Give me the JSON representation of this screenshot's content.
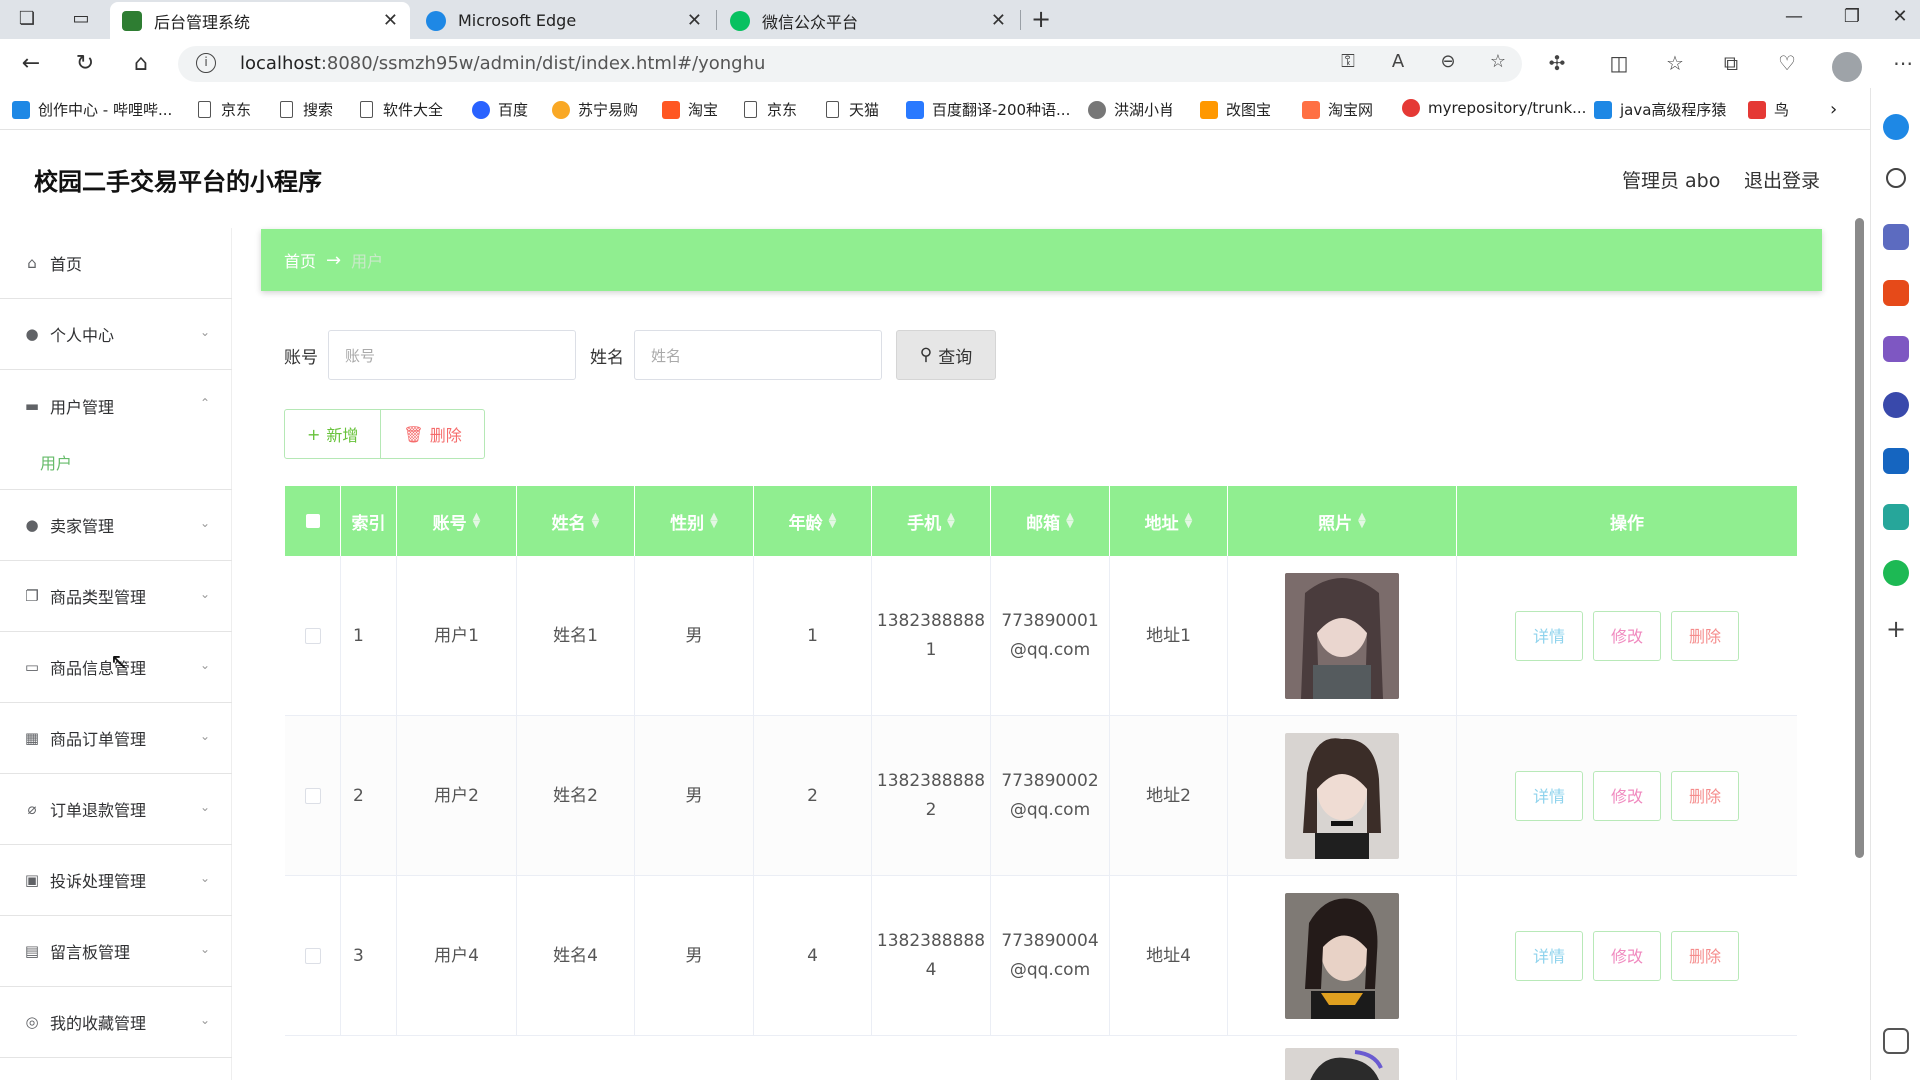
{
  "browser": {
    "tabs": [
      {
        "title": "后台管理系统",
        "color": "#2e7d32"
      },
      {
        "title": "Microsoft Edge",
        "color": "#1e88e5"
      },
      {
        "title": "微信公众平台",
        "color": "#07c160"
      }
    ],
    "url_host": "localhost",
    "url_rest": ":8080/ssmzh95w/admin/dist/index.html#/yonghu",
    "bookmarks": [
      {
        "label": "创作中心 - 哔哩哔...",
        "icon": "bilibili-icon",
        "color": "#1e88e5"
      },
      {
        "label": "京东",
        "icon": "page-icon"
      },
      {
        "label": "搜索",
        "icon": "page-icon"
      },
      {
        "label": "软件大全",
        "icon": "page-icon"
      },
      {
        "label": "百度",
        "icon": "baidu-icon",
        "color": "#2962ff"
      },
      {
        "label": "苏宁易购",
        "icon": "suning-icon",
        "color": "#f9a825"
      },
      {
        "label": "淘宝",
        "icon": "taobao-icon",
        "color": "#ff5722"
      },
      {
        "label": "京东",
        "icon": "page-icon"
      },
      {
        "label": "天猫",
        "icon": "page-icon"
      },
      {
        "label": "百度翻译-200种语...",
        "icon": "baidu-translate-icon",
        "color": "#2979ff"
      },
      {
        "label": "洪湖小肖",
        "icon": "hunter-icon",
        "color": "#777777"
      },
      {
        "label": "改图宝",
        "icon": "gaitubao-icon",
        "color": "#ff9800"
      },
      {
        "label": "淘宝网",
        "icon": "taobao-icon",
        "color": "#ff7043"
      },
      {
        "label": "myrepository/trunk...",
        "icon": "chrome-icon",
        "color": "#e53935"
      },
      {
        "label": "java高级程序猿",
        "icon": "bilibili-icon",
        "color": "#1e88e5"
      },
      {
        "label": "鸟",
        "icon": "bird-icon",
        "color": "#e53935"
      }
    ]
  },
  "app": {
    "title": "校园二手交易平台的小程序",
    "admin_label": "管理员 abo",
    "logout_label": "退出登录"
  },
  "sidebar": {
    "items": [
      {
        "label": "首页",
        "icon": "home-icon",
        "glyph": "⌂",
        "chevron": ""
      },
      {
        "label": "个人中心",
        "icon": "user-icon",
        "glyph": "●",
        "chevron": "⌄"
      },
      {
        "label": "用户管理",
        "icon": "users-icon",
        "glyph": "▬",
        "chevron": "⌃"
      },
      {
        "label": "卖家管理",
        "icon": "seller-icon",
        "glyph": "●",
        "chevron": "⌄"
      },
      {
        "label": "商品类型管理",
        "icon": "category-icon",
        "glyph": "❐",
        "chevron": "⌄"
      },
      {
        "label": "商品信息管理",
        "icon": "product-icon",
        "glyph": "▭",
        "chevron": "⌄"
      },
      {
        "label": "商品订单管理",
        "icon": "order-icon",
        "glyph": "▦",
        "chevron": "⌄"
      },
      {
        "label": "订单退款管理",
        "icon": "refund-icon",
        "glyph": "⌀",
        "chevron": "⌄"
      },
      {
        "label": "投诉处理管理",
        "icon": "complaint-icon",
        "glyph": "▣",
        "chevron": "⌄"
      },
      {
        "label": "留言板管理",
        "icon": "message-icon",
        "glyph": "▤",
        "chevron": "⌄"
      },
      {
        "label": "我的收藏管理",
        "icon": "favorite-icon",
        "glyph": "◎",
        "chevron": "⌄"
      }
    ],
    "sub_item": "用户"
  },
  "breadcrumb": {
    "home": "首页",
    "arrow": "→",
    "current": "用户"
  },
  "search": {
    "account_label": "账号",
    "account_placeholder": "账号",
    "name_label": "姓名",
    "name_placeholder": "姓名",
    "query_label": "查询"
  },
  "actions": {
    "add_label": "新增",
    "delete_label": "删除"
  },
  "table": {
    "headers": [
      "索引",
      "账号",
      "姓名",
      "性别",
      "年龄",
      "手机",
      "邮箱",
      "地址",
      "照片",
      "操作"
    ],
    "rows": [
      {
        "index": "1",
        "account": "用户1",
        "name": "姓名1",
        "gender": "男",
        "age": "1",
        "phone_1": "1382388888",
        "phone_2": "1",
        "email_1": "773890001",
        "email_2": "@qq.com",
        "address": "地址1"
      },
      {
        "index": "2",
        "account": "用户2",
        "name": "姓名2",
        "gender": "男",
        "age": "2",
        "phone_1": "1382388888",
        "phone_2": "2",
        "email_1": "773890002",
        "email_2": "@qq.com",
        "address": "地址2"
      },
      {
        "index": "3",
        "account": "用户4",
        "name": "姓名4",
        "gender": "男",
        "age": "4",
        "phone_1": "1382388888",
        "phone_2": "4",
        "email_1": "773890004",
        "email_2": "@qq.com",
        "address": "地址4"
      }
    ],
    "detail_label": "详情",
    "edit_label": "修改",
    "remove_label": "删除"
  },
  "colors": {
    "accent": "#90ee90",
    "sidebar_active": "#66bb6a"
  }
}
